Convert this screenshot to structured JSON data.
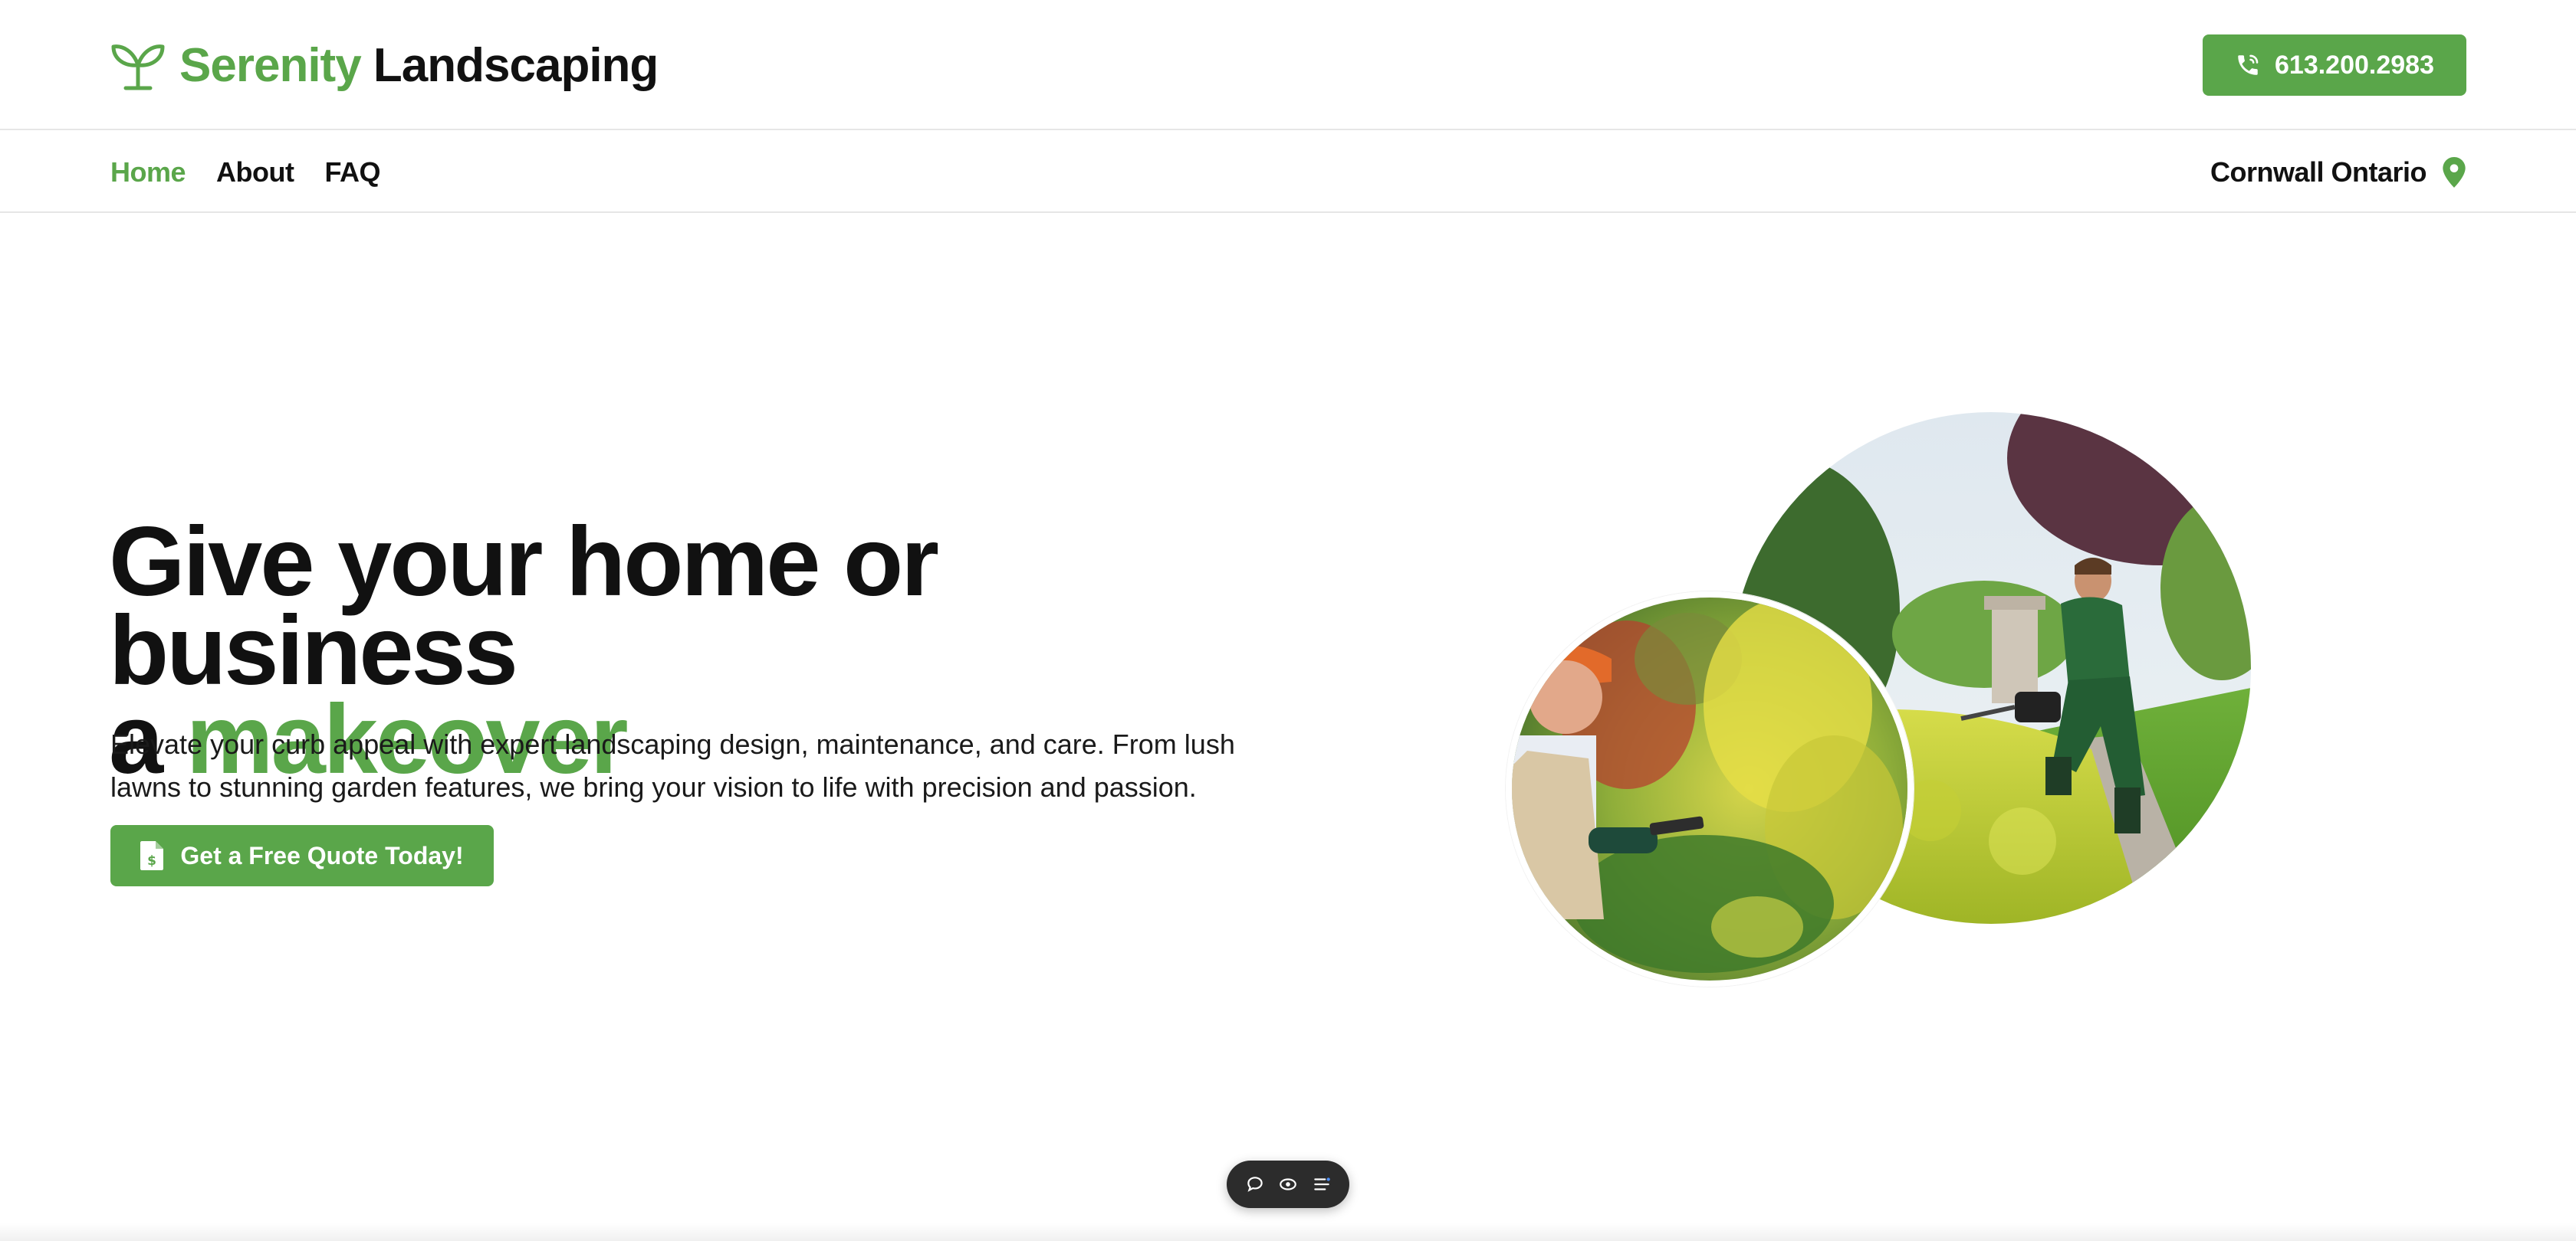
{
  "header": {
    "brand_part1": "Serenity",
    "brand_part2": "Landscaping",
    "phone": "613.200.2983"
  },
  "nav": {
    "items": [
      {
        "label": "Home",
        "active": true
      },
      {
        "label": "About",
        "active": false
      },
      {
        "label": "FAQ",
        "active": false
      }
    ],
    "location": "Cornwall Ontario"
  },
  "hero": {
    "title_line1": "Give your home or business",
    "title_line2_prefix": "a ",
    "title_highlight": "makeover",
    "description": "Elevate your curb appeal with expert landscaping design, maintenance, and care. From lush lawns to stunning garden features, we bring your vision to life with precision and passion.",
    "cta_label": "Get a Free Quote Today!"
  },
  "images": {
    "large": "landscaper-trimming-hedge-photo",
    "small": "gardener-with-tablet-photo"
  },
  "toolbar": {
    "icons": [
      "chat-icon",
      "eye-icon",
      "menu-icon"
    ]
  },
  "colors": {
    "brand_green": "#5aa64a",
    "text_dark": "#111111"
  }
}
